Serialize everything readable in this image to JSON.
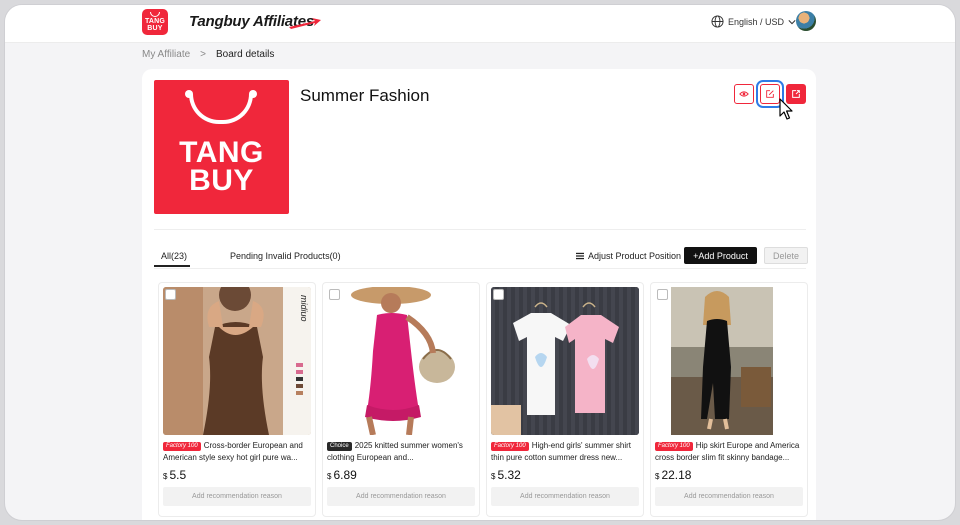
{
  "topbar": {
    "logo_text_1": "TANG",
    "logo_text_2": "BUY",
    "brand": "Tangbuy Affiliates",
    "language": "English / USD"
  },
  "breadcrumb": {
    "parent": "My Affiliate",
    "separator": ">",
    "current": "Board details"
  },
  "board": {
    "cover_text_1": "TANG",
    "cover_text_2": "BUY",
    "title": "Summer Fashion"
  },
  "tabs": {
    "all": "All(23)",
    "invalid": "Pending Invalid Products(0)"
  },
  "toolbar": {
    "adjust": "Adjust Product Position",
    "add": "+Add Product",
    "delete": "Delete"
  },
  "products": [
    {
      "tag": "Factory 100",
      "title": "Cross-border European and American style sexy hot girl pure wa...",
      "currency": "$",
      "price": "5.5",
      "reason": "Add recommendation reason",
      "image_side_text": "midiuo"
    },
    {
      "tag": "Choice",
      "title": "2025 knitted summer women's clothing European and...",
      "currency": "$",
      "price": "6.89",
      "reason": "Add recommendation reason"
    },
    {
      "tag": "Factory 100",
      "title": "High-end girls' summer shirt thin pure cotton summer dress new...",
      "currency": "$",
      "price": "5.32",
      "reason": "Add recommendation reason"
    },
    {
      "tag": "Factory 100",
      "title": "Hip skirt Europe and America cross border slim fit skinny bandage...",
      "currency": "$",
      "price": "22.18",
      "reason": "Add recommendation reason"
    }
  ],
  "colors": {
    "accent": "#f0273b",
    "focus": "#2f7be6"
  }
}
